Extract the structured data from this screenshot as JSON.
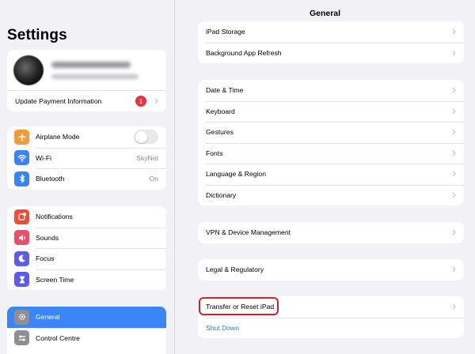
{
  "sidebar": {
    "title": "Settings",
    "account": {
      "update_label": "Update Payment Information",
      "badge_count": "1"
    },
    "group1": [
      {
        "label": "Airplane Mode",
        "icon": "airplane-icon",
        "color": "#f19a37",
        "value": ""
      },
      {
        "label": "Wi-Fi",
        "icon": "wifi-icon",
        "color": "#3a82f7",
        "value": "SkyNet"
      },
      {
        "label": "Bluetooth",
        "icon": "bluetooth-icon",
        "color": "#3a82f7",
        "value": "On"
      }
    ],
    "group2": [
      {
        "label": "Notifications",
        "icon": "bell-icon",
        "color": "#eb4e3d"
      },
      {
        "label": "Sounds",
        "icon": "speaker-icon",
        "color": "#eb4e66"
      },
      {
        "label": "Focus",
        "icon": "moon-icon",
        "color": "#5e5ce6"
      },
      {
        "label": "Screen Time",
        "icon": "hourglass-icon",
        "color": "#5e5ce6"
      }
    ],
    "group3": [
      {
        "label": "General",
        "icon": "gear-icon",
        "color": "#8e8e93",
        "selected": true
      },
      {
        "label": "Control Centre",
        "icon": "sliders-icon",
        "color": "#8e8e93"
      }
    ]
  },
  "main": {
    "title": "General",
    "group1": [
      {
        "label": "iPad Storage"
      },
      {
        "label": "Background App Refresh"
      }
    ],
    "group2": [
      {
        "label": "Date & Time"
      },
      {
        "label": "Keyboard"
      },
      {
        "label": "Gestures"
      },
      {
        "label": "Fonts"
      },
      {
        "label": "Language & Region"
      },
      {
        "label": "Dictionary"
      }
    ],
    "group3": [
      {
        "label": "VPN & Device Management"
      }
    ],
    "group4": [
      {
        "label": "Legal & Regulatory"
      }
    ],
    "group5": [
      {
        "label": "Transfer or Reset iPad",
        "highlighted": true
      },
      {
        "label": "Shut Down",
        "link": true
      }
    ]
  },
  "colors": {
    "accent": "#3a86f7",
    "highlight_border": "#d9202a",
    "badge": "#e8353b",
    "link": "#2f7fe6"
  }
}
